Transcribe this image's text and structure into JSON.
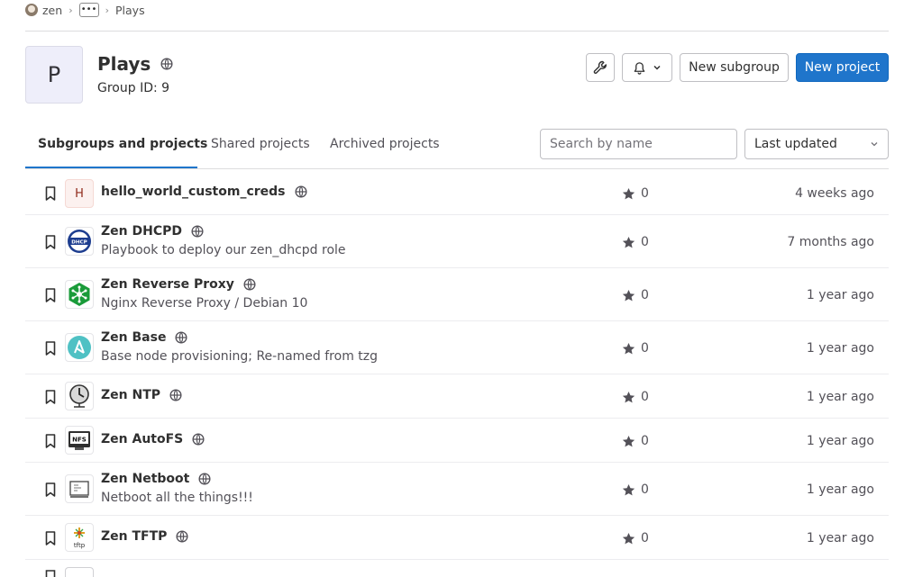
{
  "breadcrumb": {
    "user": "zen",
    "more": "•••",
    "current": "Plays"
  },
  "group": {
    "avatar_letter": "P",
    "name": "Plays",
    "id_label": "Group ID: 9"
  },
  "actions": {
    "settings_icon": "wrench-icon",
    "notifications_icon": "bell-icon",
    "new_subgroup": "New subgroup",
    "new_project": "New project"
  },
  "tabs": [
    {
      "label": "Subgroups and projects",
      "active": true
    },
    {
      "label": "Shared projects",
      "active": false
    },
    {
      "label": "Archived projects",
      "active": false
    }
  ],
  "search": {
    "placeholder": "Search by name",
    "value": ""
  },
  "sort": {
    "selected": "Last updated"
  },
  "colors": {
    "primary": "#1f75cb",
    "text": "#303030",
    "muted": "#535158",
    "border": "#dcdcde"
  },
  "projects": [
    {
      "name": "hello_world_custom_creds",
      "description": "",
      "avatar": "H",
      "avatar_icon": "letter-avatar",
      "stars": "0",
      "updated": "4 weeks ago",
      "visibility": "public"
    },
    {
      "name": "Zen DHCPD",
      "description": "Playbook to deploy our zen_dhcpd role",
      "avatar_icon": "dhcp-logo-icon",
      "avatar_text": "DHCP",
      "stars": "0",
      "updated": "7 months ago",
      "visibility": "public"
    },
    {
      "name": "Zen Reverse Proxy",
      "description": "Nginx Reverse Proxy / Debian 10",
      "avatar_icon": "nginx-hexagon-icon",
      "stars": "0",
      "updated": "1 year ago",
      "visibility": "public"
    },
    {
      "name": "Zen Base",
      "description": "Base node provisioning; Re-named from tzg",
      "avatar_icon": "ansible-icon",
      "stars": "0",
      "updated": "1 year ago",
      "visibility": "public"
    },
    {
      "name": "Zen NTP",
      "description": "",
      "avatar_icon": "clock-icon",
      "stars": "0",
      "updated": "1 year ago",
      "visibility": "public"
    },
    {
      "name": "Zen AutoFS",
      "description": "",
      "avatar_icon": "nfs-monitor-icon",
      "avatar_text": "NFS",
      "stars": "0",
      "updated": "1 year ago",
      "visibility": "public"
    },
    {
      "name": "Zen Netboot",
      "description": "Netboot all the things!!!",
      "avatar_icon": "netboot-screen-icon",
      "stars": "0",
      "updated": "1 year ago",
      "visibility": "public"
    },
    {
      "name": "Zen TFTP",
      "description": "",
      "avatar_icon": "tftp-logo-icon",
      "avatar_text": "tftp",
      "stars": "0",
      "updated": "1 year ago",
      "visibility": "public"
    }
  ]
}
